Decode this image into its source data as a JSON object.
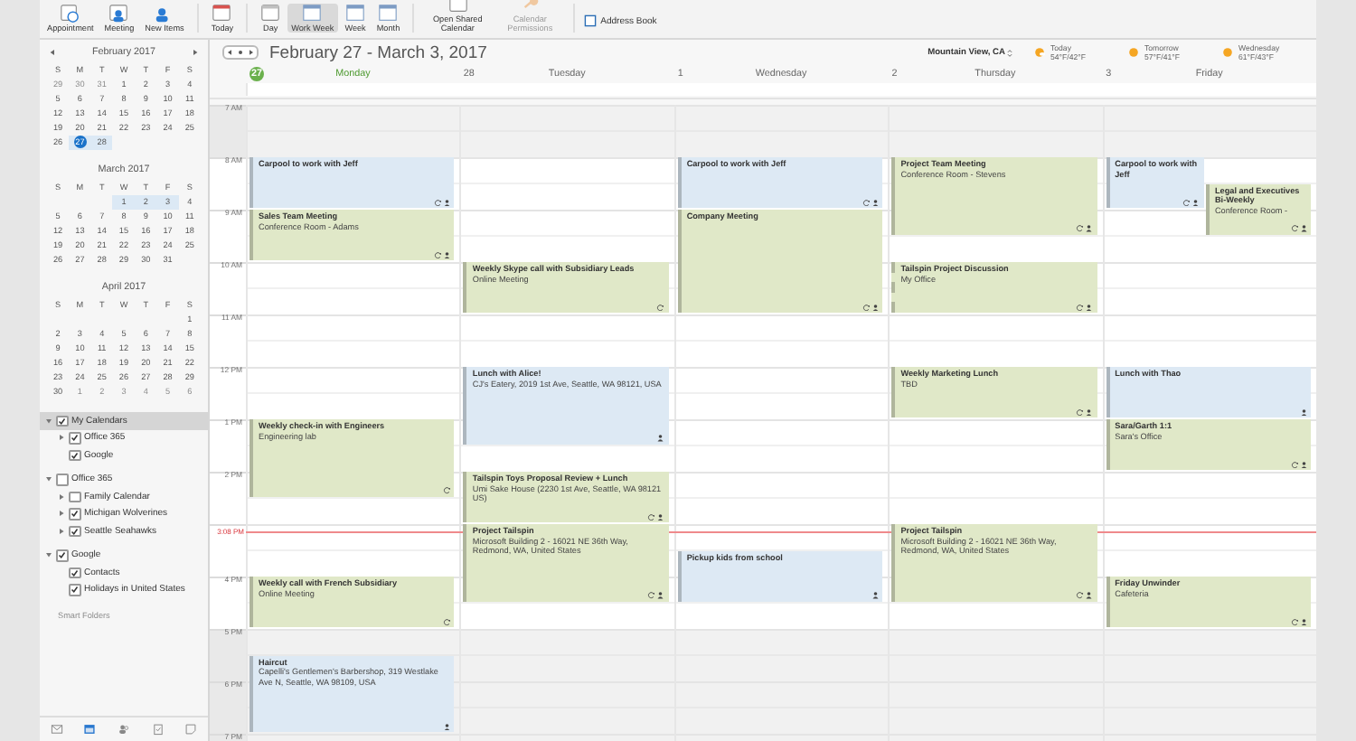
{
  "ribbon": {
    "groups": [
      [
        {
          "label": "Appointment",
          "kind": "appointment",
          "selected": false,
          "disabled": false
        },
        {
          "label": "Meeting",
          "kind": "meeting",
          "selected": false,
          "disabled": false
        },
        {
          "label": "New Items",
          "kind": "new",
          "selected": false,
          "disabled": false
        }
      ],
      [
        {
          "label": "Today",
          "kind": "today",
          "selected": false,
          "disabled": false
        }
      ],
      [
        {
          "label": "Day",
          "kind": "day",
          "selected": false,
          "disabled": false
        },
        {
          "label": "Work Week",
          "kind": "view",
          "selected": true,
          "disabled": false
        },
        {
          "label": "Week",
          "kind": "view",
          "selected": false,
          "disabled": false
        },
        {
          "label": "Month",
          "kind": "view",
          "selected": false,
          "disabled": false
        }
      ],
      [
        {
          "label": "Open Shared Calendar",
          "kind": "day",
          "selected": false,
          "disabled": false
        },
        {
          "label": "Calendar Permissions",
          "kind": "permissions",
          "selected": false,
          "disabled": true
        }
      ]
    ],
    "address_book": {
      "label": "Address Book"
    }
  },
  "sidebar": {
    "months": [
      {
        "title": "February 2017",
        "weekdays": [
          "S",
          "M",
          "T",
          "W",
          "T",
          "F",
          "S"
        ],
        "weeks": [
          [
            {
              "day": "29",
              "muted": true,
              "in_range": false,
              "selected": false
            },
            {
              "day": "30",
              "muted": true,
              "in_range": false,
              "selected": false
            },
            {
              "day": "31",
              "muted": true,
              "in_range": false,
              "selected": false
            },
            {
              "day": "1",
              "muted": false,
              "in_range": false,
              "selected": false
            },
            {
              "day": "2",
              "muted": false,
              "in_range": false,
              "selected": false
            },
            {
              "day": "3",
              "muted": false,
              "in_range": false,
              "selected": false
            },
            {
              "day": "4",
              "muted": false,
              "in_range": false,
              "selected": false
            }
          ],
          [
            {
              "day": "5",
              "muted": false,
              "in_range": false,
              "selected": false
            },
            {
              "day": "6",
              "muted": false,
              "in_range": false,
              "selected": false
            },
            {
              "day": "7",
              "muted": false,
              "in_range": false,
              "selected": false
            },
            {
              "day": "8",
              "muted": false,
              "in_range": false,
              "selected": false
            },
            {
              "day": "9",
              "muted": false,
              "in_range": false,
              "selected": false
            },
            {
              "day": "10",
              "muted": false,
              "in_range": false,
              "selected": false
            },
            {
              "day": "11",
              "muted": false,
              "in_range": false,
              "selected": false
            }
          ],
          [
            {
              "day": "12",
              "muted": false,
              "in_range": false,
              "selected": false
            },
            {
              "day": "13",
              "muted": false,
              "in_range": false,
              "selected": false
            },
            {
              "day": "14",
              "muted": false,
              "in_range": false,
              "selected": false
            },
            {
              "day": "15",
              "muted": false,
              "in_range": false,
              "selected": false
            },
            {
              "day": "16",
              "muted": false,
              "in_range": false,
              "selected": false
            },
            {
              "day": "17",
              "muted": false,
              "in_range": false,
              "selected": false
            },
            {
              "day": "18",
              "muted": false,
              "in_range": false,
              "selected": false
            }
          ],
          [
            {
              "day": "19",
              "muted": false,
              "in_range": false,
              "selected": false
            },
            {
              "day": "20",
              "muted": false,
              "in_range": false,
              "selected": false
            },
            {
              "day": "21",
              "muted": false,
              "in_range": false,
              "selected": false
            },
            {
              "day": "22",
              "muted": false,
              "in_range": false,
              "selected": false
            },
            {
              "day": "23",
              "muted": false,
              "in_range": false,
              "selected": false
            },
            {
              "day": "24",
              "muted": false,
              "in_range": false,
              "selected": false
            },
            {
              "day": "25",
              "muted": false,
              "in_range": false,
              "selected": false
            }
          ],
          [
            {
              "day": "26",
              "muted": false,
              "in_range": false,
              "selected": false
            },
            {
              "day": "27",
              "muted": false,
              "in_range": true,
              "selected": true
            },
            {
              "day": "28",
              "muted": false,
              "in_range": true,
              "selected": false
            }
          ]
        ]
      },
      {
        "title": "March 2017",
        "weekdays": [
          "S",
          "M",
          "T",
          "W",
          "T",
          "F",
          "S"
        ],
        "weeks": [
          [
            {
              "day": "1",
              "muted": false,
              "in_range": true,
              "selected": false
            },
            {
              "day": "2",
              "muted": false,
              "in_range": true,
              "selected": false
            },
            {
              "day": "3",
              "muted": false,
              "in_range": true,
              "selected": false
            },
            {
              "day": "4",
              "muted": false,
              "in_range": false,
              "selected": false
            }
          ],
          [
            {
              "day": "5",
              "muted": false,
              "in_range": false,
              "selected": false
            },
            {
              "day": "6",
              "muted": false,
              "in_range": false,
              "selected": false
            },
            {
              "day": "7",
              "muted": false,
              "in_range": false,
              "selected": false
            },
            {
              "day": "8",
              "muted": false,
              "in_range": false,
              "selected": false
            },
            {
              "day": "9",
              "muted": false,
              "in_range": false,
              "selected": false
            },
            {
              "day": "10",
              "muted": false,
              "in_range": false,
              "selected": false
            },
            {
              "day": "11",
              "muted": false,
              "in_range": false,
              "selected": false
            }
          ],
          [
            {
              "day": "12",
              "muted": false,
              "in_range": false,
              "selected": false
            },
            {
              "day": "13",
              "muted": false,
              "in_range": false,
              "selected": false
            },
            {
              "day": "14",
              "muted": false,
              "in_range": false,
              "selected": false
            },
            {
              "day": "15",
              "muted": false,
              "in_range": false,
              "selected": false
            },
            {
              "day": "16",
              "muted": false,
              "in_range": false,
              "selected": false
            },
            {
              "day": "17",
              "muted": false,
              "in_range": false,
              "selected": false
            },
            {
              "day": "18",
              "muted": false,
              "in_range": false,
              "selected": false
            }
          ],
          [
            {
              "day": "19",
              "muted": false,
              "in_range": false,
              "selected": false
            },
            {
              "day": "20",
              "muted": false,
              "in_range": false,
              "selected": false
            },
            {
              "day": "21",
              "muted": false,
              "in_range": false,
              "selected": false
            },
            {
              "day": "22",
              "muted": false,
              "in_range": false,
              "selected": false
            },
            {
              "day": "23",
              "muted": false,
              "in_range": false,
              "selected": false
            },
            {
              "day": "24",
              "muted": false,
              "in_range": false,
              "selected": false
            },
            {
              "day": "25",
              "muted": false,
              "in_range": false,
              "selected": false
            }
          ],
          [
            {
              "day": "26",
              "muted": false,
              "in_range": false,
              "selected": false
            },
            {
              "day": "27",
              "muted": false,
              "in_range": false,
              "selected": false
            },
            {
              "day": "28",
              "muted": false,
              "in_range": false,
              "selected": false
            },
            {
              "day": "29",
              "muted": false,
              "in_range": false,
              "selected": false
            },
            {
              "day": "30",
              "muted": false,
              "in_range": false,
              "selected": false
            },
            {
              "day": "31",
              "muted": false,
              "in_range": false,
              "selected": false
            }
          ]
        ]
      },
      {
        "title": "April 2017",
        "weekdays": [
          "S",
          "M",
          "T",
          "W",
          "T",
          "F",
          "S"
        ],
        "weeks": [
          [
            {
              "day": "1",
              "muted": false,
              "in_range": false,
              "selected": false
            }
          ],
          [
            {
              "day": "2",
              "muted": false,
              "in_range": false,
              "selected": false
            },
            {
              "day": "3",
              "muted": false,
              "in_range": false,
              "selected": false
            },
            {
              "day": "4",
              "muted": false,
              "in_range": false,
              "selected": false
            },
            {
              "day": "5",
              "muted": false,
              "in_range": false,
              "selected": false
            },
            {
              "day": "6",
              "muted": false,
              "in_range": false,
              "selected": false
            },
            {
              "day": "7",
              "muted": false,
              "in_range": false,
              "selected": false
            },
            {
              "day": "8",
              "muted": false,
              "in_range": false,
              "selected": false
            }
          ],
          [
            {
              "day": "9",
              "muted": false,
              "in_range": false,
              "selected": false
            },
            {
              "day": "10",
              "muted": false,
              "in_range": false,
              "selected": false
            },
            {
              "day": "11",
              "muted": false,
              "in_range": false,
              "selected": false
            },
            {
              "day": "12",
              "muted": false,
              "in_range": false,
              "selected": false
            },
            {
              "day": "13",
              "muted": false,
              "in_range": false,
              "selected": false
            },
            {
              "day": "14",
              "muted": false,
              "in_range": false,
              "selected": false
            },
            {
              "day": "15",
              "muted": false,
              "in_range": false,
              "selected": false
            }
          ],
          [
            {
              "day": "16",
              "muted": false,
              "in_range": false,
              "selected": false
            },
            {
              "day": "17",
              "muted": false,
              "in_range": false,
              "selected": false
            },
            {
              "day": "18",
              "muted": false,
              "in_range": false,
              "selected": false
            },
            {
              "day": "19",
              "muted": false,
              "in_range": false,
              "selected": false
            },
            {
              "day": "20",
              "muted": false,
              "in_range": false,
              "selected": false
            },
            {
              "day": "21",
              "muted": false,
              "in_range": false,
              "selected": false
            },
            {
              "day": "22",
              "muted": false,
              "in_range": false,
              "selected": false
            }
          ],
          [
            {
              "day": "23",
              "muted": false,
              "in_range": false,
              "selected": false
            },
            {
              "day": "24",
              "muted": false,
              "in_range": false,
              "selected": false
            },
            {
              "day": "25",
              "muted": false,
              "in_range": false,
              "selected": false
            },
            {
              "day": "26",
              "muted": false,
              "in_range": false,
              "selected": false
            },
            {
              "day": "27",
              "muted": false,
              "in_range": false,
              "selected": false
            },
            {
              "day": "28",
              "muted": false,
              "in_range": false,
              "selected": false
            },
            {
              "day": "29",
              "muted": false,
              "in_range": false,
              "selected": false
            }
          ],
          [
            {
              "day": "30",
              "muted": false,
              "in_range": false,
              "selected": false
            },
            {
              "day": "1",
              "muted": true,
              "in_range": false,
              "selected": false
            },
            {
              "day": "2",
              "muted": true,
              "in_range": false,
              "selected": false
            },
            {
              "day": "3",
              "muted": true,
              "in_range": false,
              "selected": false
            },
            {
              "day": "4",
              "muted": true,
              "in_range": false,
              "selected": false
            },
            {
              "day": "5",
              "muted": true,
              "in_range": false,
              "selected": false
            },
            {
              "day": "6",
              "muted": true,
              "in_range": false,
              "selected": false
            }
          ]
        ]
      }
    ],
    "calendars": [
      {
        "label": "My Calendars",
        "checked": true,
        "expanded": true,
        "selected": true,
        "children": [
          {
            "label": "Office 365",
            "checked": true,
            "expanded": false,
            "selected": false
          },
          {
            "label": "Google",
            "checked": true,
            "selected": false
          }
        ]
      },
      {
        "label": "Office 365",
        "checked": false,
        "expanded": true,
        "selected": false,
        "children": [
          {
            "label": "Family Calendar",
            "checked": false,
            "expanded": false,
            "selected": false
          },
          {
            "label": "Michigan Wolverines",
            "checked": true,
            "expanded": false,
            "selected": false
          },
          {
            "label": "Seattle Seahawks",
            "checked": true,
            "expanded": false,
            "selected": false
          }
        ]
      },
      {
        "label": "Google",
        "checked": true,
        "expanded": true,
        "selected": false,
        "children": [
          {
            "label": "Contacts",
            "checked": true,
            "selected": false
          },
          {
            "label": "Holidays in United States",
            "checked": true,
            "selected": false
          }
        ]
      }
    ],
    "smart_folders": "Smart Folders",
    "nav_icons": [
      {
        "kind": "mail",
        "selected": false
      },
      {
        "kind": "calendar",
        "selected": true
      },
      {
        "kind": "contacts",
        "selected": false
      },
      {
        "kind": "tasks",
        "selected": false
      },
      {
        "kind": "notes",
        "selected": false
      }
    ]
  },
  "calendar": {
    "title": "February 27 - March 3, 2017",
    "location": "Mountain View, CA",
    "forecast": [
      {
        "day": "Today",
        "temps": "54°F/42°F",
        "kind": "cloudy"
      },
      {
        "day": "Tomorrow",
        "temps": "57°F/41°F",
        "kind": "sunny"
      },
      {
        "day": "Wednesday",
        "temps": "61°F/43°F",
        "kind": "sunny"
      }
    ],
    "hours": [
      {
        "label": "7 AM",
        "working": false
      },
      {
        "label": "8 AM",
        "working": true
      },
      {
        "label": "9 AM",
        "working": true
      },
      {
        "label": "10 AM",
        "working": true
      },
      {
        "label": "11 AM",
        "working": true
      },
      {
        "label": "12 PM",
        "working": true
      },
      {
        "label": "1 PM",
        "working": true
      },
      {
        "label": "2 PM",
        "working": true
      },
      {
        "working": true
      },
      {
        "label": "4 PM",
        "working": true
      },
      {
        "label": "5 PM",
        "working": false
      },
      {
        "label": "6 PM",
        "working": false
      },
      {
        "label": "7 PM",
        "working": false
      }
    ],
    "now": {
      "label": "3:08 PM"
    },
    "days": [
      {
        "date": "27",
        "name": "Monday",
        "today": true,
        "events": [
          {
            "title": "Carpool to work with Jeff",
            "color": "#dde9f4",
            "recurring": true,
            "attendees": true,
            "tentative": false
          },
          {
            "title": "Sales Team Meeting",
            "location": "Conference Room - Adams",
            "color": "#e0e8c8",
            "recurring": true,
            "attendees": true,
            "tentative": false
          },
          {
            "title": "Weekly check-in with Engineers",
            "location": "Engineering lab",
            "color": "#e0e8c8",
            "recurring": true,
            "attendees": false,
            "tentative": false
          },
          {
            "title": "Weekly call with French Subsidiary",
            "location": "Online Meeting",
            "color": "#e0e8c8",
            "recurring": true,
            "attendees": false,
            "tentative": false
          },
          {
            "title": "Haircut",
            "location": "Capelli's Gentlemen's Barbershop, 319 Westlake Ave N, Seattle, WA 98109, USA",
            "color": "#dde9f4",
            "recurring": false,
            "attendees": true,
            "tentative": false
          }
        ]
      },
      {
        "date": "28",
        "name": "Tuesday",
        "today": false,
        "events": [
          {
            "title": "Weekly Skype call with Subsidiary Leads",
            "location": "Online Meeting",
            "color": "#e0e8c8",
            "recurring": true,
            "attendees": false,
            "tentative": false
          },
          {
            "title": "Lunch with Alice!",
            "location": "CJ's Eatery, 2019 1st Ave, Seattle, WA 98121, USA",
            "color": "#dde9f4",
            "recurring": false,
            "attendees": true,
            "tentative": false
          },
          {
            "title": "Tailspin Toys Proposal Review + Lunch",
            "location": "Umi Sake House (2230 1st Ave, Seattle, WA 98121 US)",
            "color": "#e0e8c8",
            "recurring": true,
            "attendees": true,
            "tentative": false
          },
          {
            "title": "Project Tailspin",
            "location": "Microsoft Building 2 - 16021 NE 36th Way, Redmond, WA, United States",
            "color": "#e0e8c8",
            "recurring": true,
            "attendees": true,
            "tentative": false
          }
        ]
      },
      {
        "date": "1",
        "name": "Wednesday",
        "today": false,
        "events": [
          {
            "title": "Carpool to work with Jeff",
            "color": "#dde9f4",
            "recurring": true,
            "attendees": true,
            "tentative": false
          },
          {
            "title": "Company Meeting",
            "color": "#e0e8c8",
            "recurring": true,
            "attendees": true,
            "tentative": false
          },
          {
            "title": "Pickup kids from school",
            "color": "#dde9f4",
            "recurring": false,
            "attendees": true,
            "tentative": false
          }
        ]
      },
      {
        "date": "2",
        "name": "Thursday",
        "today": false,
        "events": [
          {
            "title": "Project Team Meeting",
            "location": "Conference Room - Stevens",
            "color": "#e0e8c8",
            "recurring": true,
            "attendees": true,
            "tentative": false
          },
          {
            "title": "Tailspin Project Discussion",
            "location": "My Office",
            "color": "#e0e8c8",
            "recurring": true,
            "attendees": true,
            "tentative": true
          },
          {
            "title": "Weekly Marketing Lunch",
            "location": "TBD",
            "color": "#e0e8c8",
            "recurring": true,
            "attendees": true,
            "tentative": false
          },
          {
            "title": "Project Tailspin",
            "location": "Microsoft Building 2 - 16021 NE 36th Way, Redmond, WA, United States",
            "color": "#e0e8c8",
            "recurring": true,
            "attendees": true,
            "tentative": false
          }
        ]
      },
      {
        "date": "3",
        "name": "Friday",
        "today": false,
        "events": [
          {
            "title": "Carpool to work with Jeff",
            "color": "#dde9f4",
            "recurring": true,
            "attendees": true,
            "tentative": false
          },
          {
            "title": "Legal and Executives Bi-Weekly",
            "location": "Conference Room -",
            "color": "#e0e8c8",
            "recurring": true,
            "attendees": true,
            "tentative": false
          },
          {
            "title": "Lunch with Thao",
            "color": "#dde9f4",
            "recurring": false,
            "attendees": true,
            "tentative": false
          },
          {
            "title": "Sara/Garth 1:1",
            "location": "Sara's Office",
            "color": "#e0e8c8",
            "recurring": true,
            "attendees": true,
            "tentative": false
          },
          {
            "title": "Friday Unwinder",
            "location": "Cafeteria",
            "color": "#e0e8c8",
            "recurring": true,
            "attendees": true,
            "tentative": false
          }
        ]
      }
    ]
  }
}
